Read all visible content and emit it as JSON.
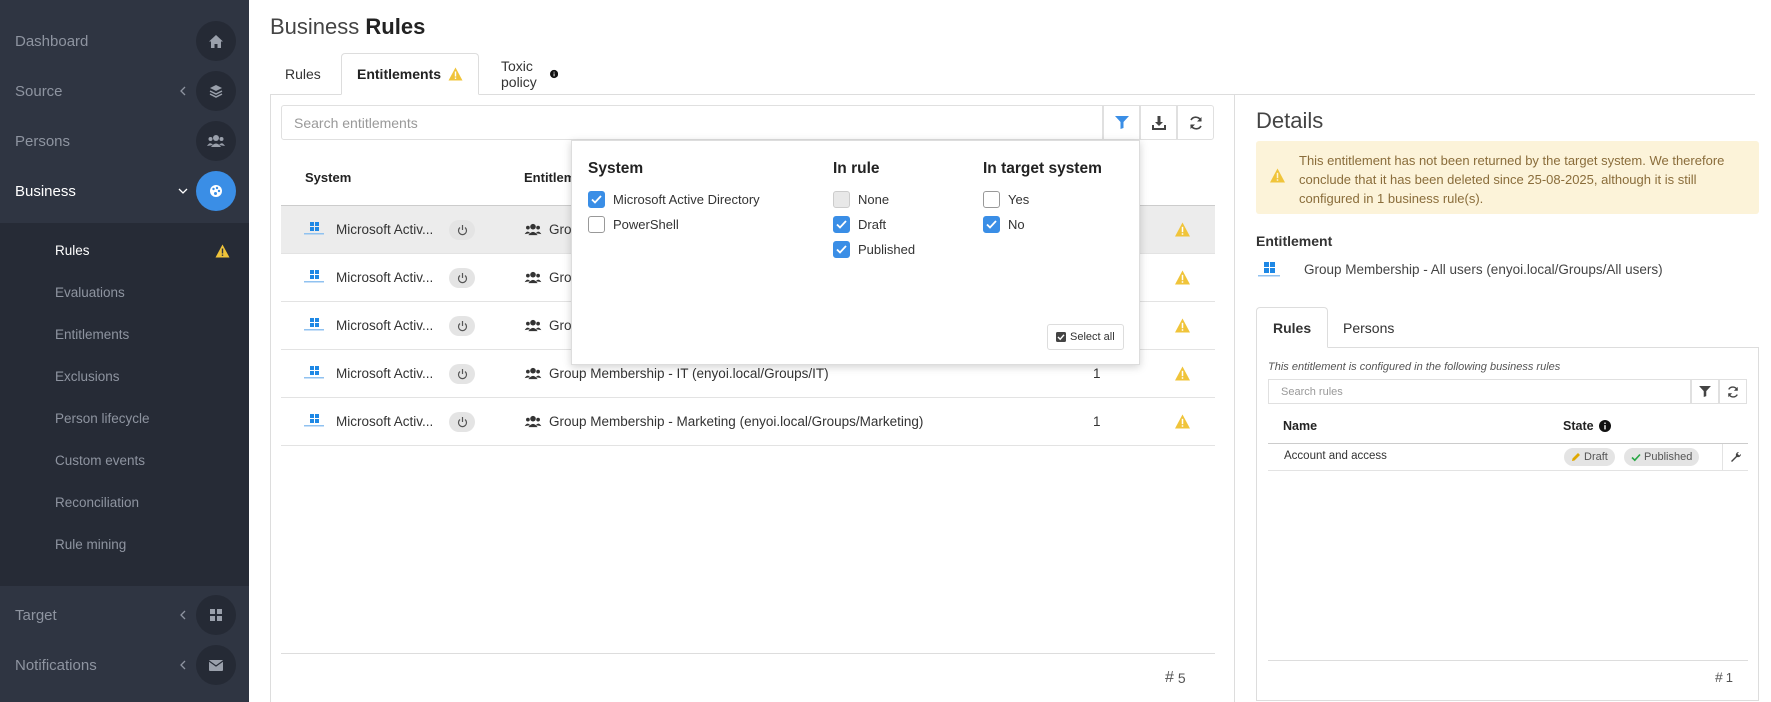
{
  "sidebar": {
    "items": [
      {
        "label": "Dashboard",
        "icon": "home-icon"
      },
      {
        "label": "Source",
        "icon": "layers-icon"
      },
      {
        "label": "Persons",
        "icon": "users-icon"
      },
      {
        "label": "Business",
        "icon": "palette-icon"
      },
      {
        "label": "Target",
        "icon": "grid-icon"
      },
      {
        "label": "Notifications",
        "icon": "mail-icon"
      }
    ],
    "sub_items": [
      "Rules",
      "Evaluations",
      "Entitlements",
      "Exclusions",
      "Person lifecycle",
      "Custom events",
      "Reconciliation",
      "Rule mining"
    ]
  },
  "header": {
    "title_prefix": "Business",
    "title_bold": "Rules"
  },
  "tabs": [
    {
      "label": "Rules"
    },
    {
      "label": "Entitlements"
    },
    {
      "label": "Toxic policy"
    }
  ],
  "search": {
    "placeholder": "Search entitlements"
  },
  "table": {
    "columns": [
      "System",
      "Entitlem"
    ],
    "rows": [
      {
        "system": "Microsoft Activ...",
        "entitlement": "Grou",
        "count": ""
      },
      {
        "system": "Microsoft Activ...",
        "entitlement": "Grou",
        "count": ""
      },
      {
        "system": "Microsoft Activ...",
        "entitlement": "Grou",
        "count": ""
      },
      {
        "system": "Microsoft Activ...",
        "entitlement": "Group Membership - IT (enyoi.local/Groups/IT)",
        "count": "1"
      },
      {
        "system": "Microsoft Activ...",
        "entitlement": "Group Membership - Marketing (enyoi.local/Groups/Marketing)",
        "count": "1"
      }
    ],
    "total_count": "5"
  },
  "filter": {
    "system_title": "System",
    "system_options": [
      "Microsoft Active Directory",
      "PowerShell"
    ],
    "rule_title": "In rule",
    "rule_options": [
      "None",
      "Draft",
      "Published"
    ],
    "target_title": "In target system",
    "target_options": [
      "Yes",
      "No"
    ],
    "select_all": "Select all"
  },
  "details": {
    "title": "Details",
    "warning": "This entitlement has not been returned by the target system. We therefore conclude that it has been deleted since 25-08-2025, although it is still configured in 1 business rule(s).",
    "entitlement_label": "Entitlement",
    "entitlement_name": "Group Membership - All users (enyoi.local/Groups/All users)",
    "tabs": [
      "Rules",
      "Persons"
    ],
    "hint": "This entitlement is configured in the following business rules",
    "search_placeholder": "Search rules",
    "columns": [
      "Name",
      "State"
    ],
    "rows": [
      {
        "name": "Account and access",
        "states": [
          "Draft",
          "Published"
        ]
      }
    ],
    "count": "1"
  },
  "colors": {
    "accent": "#3a8ee6",
    "warning": "#f0c43a",
    "sidebar_bg": "#2f3542"
  }
}
